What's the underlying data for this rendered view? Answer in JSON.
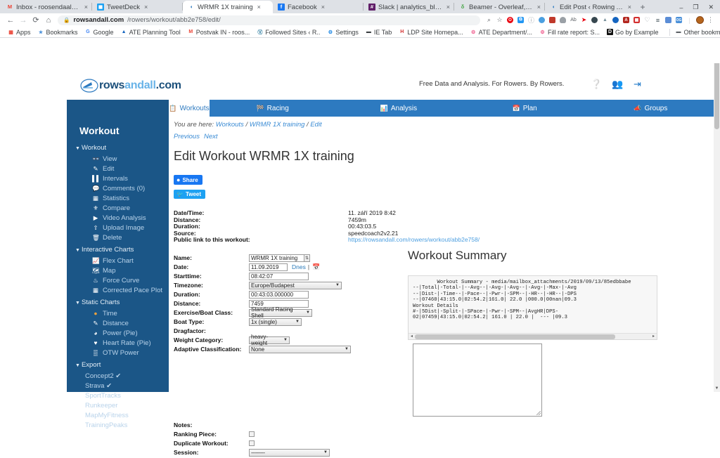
{
  "browser": {
    "tabs": [
      {
        "title": "Inbox - roosendaalsander@g",
        "favicon": "gmail-icon",
        "glyph": "M",
        "color": "#ea4335",
        "bg": "transparent",
        "active": false
      },
      {
        "title": "TweetDeck",
        "favicon": "tweetdeck-icon",
        "glyph": "■",
        "color": "#ffffff",
        "bg": "#1da1f2",
        "active": false
      },
      {
        "title": "WRMR 1X training",
        "favicon": "rowsandall-icon",
        "glyph": "◖",
        "color": "#2d7ac0",
        "bg": "transparent",
        "active": true
      },
      {
        "title": "Facebook",
        "favicon": "facebook-icon",
        "glyph": "f",
        "color": "#ffffff",
        "bg": "#1877f2",
        "active": false
      },
      {
        "title": "Slack | analytics_blog | rows",
        "favicon": "slack-icon",
        "glyph": "#",
        "color": "#ffffff",
        "bg": "#611f69",
        "active": false
      },
      {
        "title": "Beamer - Overleaf, Online LaT",
        "favicon": "overleaf-icon",
        "glyph": "δ",
        "color": "#46a546",
        "bg": "transparent",
        "active": false
      },
      {
        "title": "Edit Post ‹ Rowing Analytics",
        "favicon": "wordpress-icon",
        "glyph": "◖",
        "color": "#2d7ac0",
        "bg": "transparent",
        "active": false
      }
    ],
    "new_tab_label": "+",
    "close_label": "×",
    "window_controls": {
      "minimize": "–",
      "maximize": "❐",
      "close": "✕"
    },
    "nav": {
      "back": "←",
      "forward": "→",
      "reload": "⟳",
      "home": "⌂"
    },
    "omnibox": {
      "lock": "🔒",
      "host": "rowsandall.com",
      "path": "/rowers/workout/abb2e758/edit/"
    },
    "toolbar_icons": [
      {
        "name": "zoom-icon",
        "glyph": "⌕",
        "color": "#5f6368",
        "bg": "transparent"
      },
      {
        "name": "bookmark-star-icon",
        "glyph": "☆",
        "color": "#5f6368",
        "bg": "transparent"
      },
      {
        "name": "opera-extension-icon",
        "glyph": "O",
        "color": "#ffffff",
        "bg": "#e8000d"
      },
      {
        "name": "tabs-extension-icon",
        "glyph": "⧉",
        "color": "#ffffff",
        "bg": "#2196f3"
      },
      {
        "name": "info-extension-icon",
        "glyph": "ⓘ",
        "color": "#9aa0a6",
        "bg": "transparent"
      },
      {
        "name": "blue-circle-extension-icon",
        "glyph": "◔",
        "color": "#ffffff",
        "bg": "#4a9fe0"
      },
      {
        "name": "toolbox-extension-icon",
        "glyph": "■",
        "color": "#ffffff",
        "bg": "#c0392b"
      },
      {
        "name": "ghost-extension-icon",
        "glyph": "●",
        "color": "#ffffff",
        "bg": "#9aa0a6"
      },
      {
        "name": "grammar-extension-icon",
        "glyph": "Ab",
        "color": "#5f6368",
        "bg": "transparent"
      },
      {
        "name": "pin-extension-icon",
        "glyph": "✈",
        "color": "#e8000d",
        "bg": "transparent"
      },
      {
        "name": "clock-extension-icon",
        "glyph": "◔",
        "color": "#ffffff",
        "bg": "#37474f"
      },
      {
        "name": "mountain-extension-icon",
        "glyph": "⛰",
        "color": "#78909c",
        "bg": "transparent"
      },
      {
        "name": "globe-extension-icon",
        "glyph": "●",
        "color": "#ffffff",
        "bg": "#1565c0"
      },
      {
        "name": "acrobat-extension-icon",
        "glyph": "A",
        "color": "#ffffff",
        "bg": "#b3261e"
      },
      {
        "name": "grid-extension-icon",
        "glyph": "▦",
        "color": "#ffffff",
        "bg": "#d32f2f"
      },
      {
        "name": "shield-extension-icon",
        "glyph": "♡",
        "color": "#9aa0a6",
        "bg": "transparent"
      },
      {
        "name": "stack-extension-icon",
        "glyph": "≡",
        "color": "#37474f",
        "bg": "transparent"
      },
      {
        "name": "pocket-extension-icon",
        "glyph": "■",
        "color": "#ffffff",
        "bg": "#5b8dd6"
      },
      {
        "name": "og-extension-icon",
        "glyph": "OG",
        "color": "#ffffff",
        "bg": "#4a90d9"
      }
    ],
    "profile_avatar": "profile-avatar",
    "menu_glyph": "⋮",
    "bookmarks": [
      {
        "label": "Apps",
        "icon": "apps-grid-icon",
        "glyph": "⌸",
        "color": "#ea4335"
      },
      {
        "label": "Bookmarks",
        "icon": "star-icon",
        "glyph": "★",
        "color": "#4a90d9"
      },
      {
        "label": "Google",
        "icon": "google-icon",
        "glyph": "G",
        "color": "#4285f4"
      },
      {
        "label": "ATE Planning Tool",
        "icon": "planning-icon",
        "glyph": "▲",
        "color": "#1565c0"
      },
      {
        "label": "Postvak IN - roos...",
        "icon": "gmail-icon",
        "glyph": "M",
        "color": "#ea4335"
      },
      {
        "label": "Followed Sites ‹ R..",
        "icon": "wordpress-icon",
        "glyph": "W",
        "color": "#21759b"
      },
      {
        "label": "Settings",
        "icon": "gear-icon",
        "glyph": "⚙",
        "color": "#1e88e5"
      },
      {
        "label": "IE Tab",
        "icon": "folder-icon",
        "glyph": "▬",
        "color": "#3c4043"
      },
      {
        "label": "LDP Site Homepa...",
        "icon": "h-icon",
        "glyph": "H",
        "color": "#d32f2f"
      },
      {
        "label": "ATE Department/...",
        "icon": "gear-icon",
        "glyph": "⚙",
        "color": "#f06292"
      },
      {
        "label": "Fill rate report: S...",
        "icon": "gear-icon",
        "glyph": "⚙",
        "color": "#f06292"
      },
      {
        "label": "Go by Example",
        "icon": "go-icon",
        "glyph": "D",
        "color": "#ffffff"
      }
    ],
    "other_bookmarks": {
      "label": "Other bookmarks",
      "icon": "folder-icon",
      "glyph": "▬"
    }
  },
  "site": {
    "logo_text_1": "rows",
    "logo_text_2": "andall",
    "logo_text_3": ".com",
    "tagline": "Free Data and Analysis. For Rowers. By Rowers.",
    "header_icons": [
      {
        "name": "help-icon",
        "glyph": "?"
      },
      {
        "name": "group-icon",
        "glyph": "👥"
      },
      {
        "name": "logout-icon",
        "glyph": "↪"
      }
    ],
    "nav_tabs": [
      {
        "label": "Workouts",
        "icon": "clipboard-icon",
        "glyph": "☷",
        "active": true
      },
      {
        "label": "Racing",
        "icon": "flag-icon",
        "glyph": "⚑",
        "active": false
      },
      {
        "label": "Analysis",
        "icon": "bar-chart-icon",
        "glyph": "☰",
        "active": false
      },
      {
        "label": "Plan",
        "icon": "calendar-icon",
        "glyph": "▦",
        "active": false
      },
      {
        "label": "Groups",
        "icon": "megaphone-icon",
        "glyph": "◀",
        "active": false
      }
    ]
  },
  "sidebar": {
    "title": "Workout",
    "groups": [
      {
        "label": "Workout",
        "items": [
          {
            "label": "View",
            "icon": "glasses-icon",
            "glyph": "◑"
          },
          {
            "label": "Edit",
            "icon": "pencil-icon",
            "glyph": "✎"
          },
          {
            "label": "Intervals",
            "icon": "bars-icon",
            "glyph": "▐"
          },
          {
            "label": "Comments (0)",
            "icon": "comment-icon",
            "glyph": "☁"
          },
          {
            "label": "Statistics",
            "icon": "table-icon",
            "glyph": "▦"
          },
          {
            "label": "Compare",
            "icon": "compare-icon",
            "glyph": "⚔"
          },
          {
            "label": "Video Analysis",
            "icon": "video-icon",
            "glyph": "▶"
          },
          {
            "label": "Upload Image",
            "icon": "upload-icon",
            "glyph": "⇧"
          },
          {
            "label": "Delete",
            "icon": "trash-icon",
            "glyph": "🗑"
          }
        ]
      },
      {
        "label": "Interactive Charts",
        "items": [
          {
            "label": "Flex Chart",
            "icon": "line-chart-icon",
            "glyph": "↗"
          },
          {
            "label": "Map",
            "icon": "map-icon",
            "glyph": "◬"
          },
          {
            "label": "Force Curve",
            "icon": "force-curve-icon",
            "glyph": "≈"
          },
          {
            "label": "Corrected Pace Plot",
            "icon": "grid-chart-icon",
            "glyph": "▦"
          }
        ]
      },
      {
        "label": "Static Charts",
        "items": [
          {
            "label": "Time",
            "icon": "drop-icon",
            "glyph": "●"
          },
          {
            "label": "Distance",
            "icon": "ruler-icon",
            "glyph": "✒"
          },
          {
            "label": "Power (Pie)",
            "icon": "pie-icon",
            "glyph": "◔"
          },
          {
            "label": "Heart Rate (Pie)",
            "icon": "heart-icon",
            "glyph": "♥"
          },
          {
            "label": "OTW Power",
            "icon": "bar-icon",
            "glyph": "▒"
          }
        ]
      },
      {
        "label": "Export",
        "items": [
          {
            "label": "Concept2 ✔",
            "icon": "",
            "glyph": ""
          },
          {
            "label": "Strava ✔",
            "icon": "",
            "glyph": ""
          },
          {
            "label": "SportTracks",
            "icon": "",
            "glyph": ""
          },
          {
            "label": "Runkeeper",
            "icon": "",
            "glyph": ""
          },
          {
            "label": "MapMyFitness",
            "icon": "",
            "glyph": ""
          },
          {
            "label": "TrainingPeaks",
            "icon": "",
            "glyph": ""
          }
        ]
      }
    ]
  },
  "breadcrumb": {
    "prefix": "You are here:",
    "items": [
      "Workouts",
      "WRMR 1X training",
      "Edit"
    ],
    "separator": "/"
  },
  "pager": {
    "previous": "Previous",
    "next": "Next"
  },
  "page_title": "Edit Workout WRMR 1X training",
  "share": {
    "facebook_label": "Share",
    "facebook_glyph": "f",
    "twitter_label": "Tweet",
    "twitter_glyph": "🐦"
  },
  "meta": [
    {
      "label": "Date/Time:",
      "value": "11. září 2019 8:42",
      "link": false
    },
    {
      "label": "Distance:",
      "value": "7459m",
      "link": false
    },
    {
      "label": "Duration:",
      "value": "00:43:03.5",
      "link": false
    },
    {
      "label": "Source:",
      "value": "speedcoach2v2.21",
      "link": false
    },
    {
      "label": "Public link to this workout:",
      "value": "https://rowsandall.com/rowers/workout/abb2e758/",
      "link": true
    }
  ],
  "form": {
    "name": {
      "label": "Name:",
      "value": "WRMR 1X training"
    },
    "date": {
      "label": "Date:",
      "value": "11.09.2019",
      "today_link": "Dnes",
      "sep": "|"
    },
    "starttime": {
      "label": "Starttime:",
      "value": "08:42:07"
    },
    "timezone": {
      "label": "Timezone:",
      "value": "Europe/Budapest"
    },
    "duration": {
      "label": "Duration:",
      "value": "00:43:03.000000"
    },
    "distance": {
      "label": "Distance:",
      "value": "7459"
    },
    "boatclass": {
      "label": "Exercise/Boat Class:",
      "value": "Standard Racing Shell"
    },
    "boattype": {
      "label": "Boat Type:",
      "value": "1x (single)"
    },
    "dragfactor": {
      "label": "Dragfactor:",
      "value": ""
    },
    "weightcat": {
      "label": "Weight Category:",
      "value": "heavy-weight"
    },
    "adaptive": {
      "label": "Adaptive Classification:",
      "value": "None"
    },
    "notes": {
      "label": "Notes:",
      "value": ""
    },
    "ranking": {
      "label": "Ranking Piece:",
      "checked": false
    },
    "duplicate": {
      "label": "Duplicate Workout:",
      "checked": false
    },
    "session": {
      "label": "Session:",
      "value": "---------"
    }
  },
  "summary": {
    "title": "Workout Summary",
    "text": "        Workout Summary - media/mailbox_attachments/2019/09/13/85edbbabe\n--|Total|-Total-|--Avg--|-Avg-|-Avg--|-Avg-|-Max-|-Avg\n--|Dist-|-Time--|-Pace--|-Pwr-|-SPM--|-HR--|-HR--|-DPS\n--|07460|43:15.0|02:54.2|161.0| 22.0 |000.0|00nan|09.3\nWorkout Details\n#-|5Dist|-Split-|-SPace-|-Pwr-|-SPM--|AvgHR|DPS-\n02|07459|43:15.0|02:54.2| 161.0 | 22.0 |  --- |09.3",
    "scroll_left": "◂",
    "scroll_right": "▸"
  },
  "colors": {
    "brand_blue": "#2d7ac0",
    "sidebar_blue": "#1b5687",
    "link_blue": "#3a8bd4",
    "facebook": "#1877f2",
    "twitter": "#1da1f2"
  }
}
